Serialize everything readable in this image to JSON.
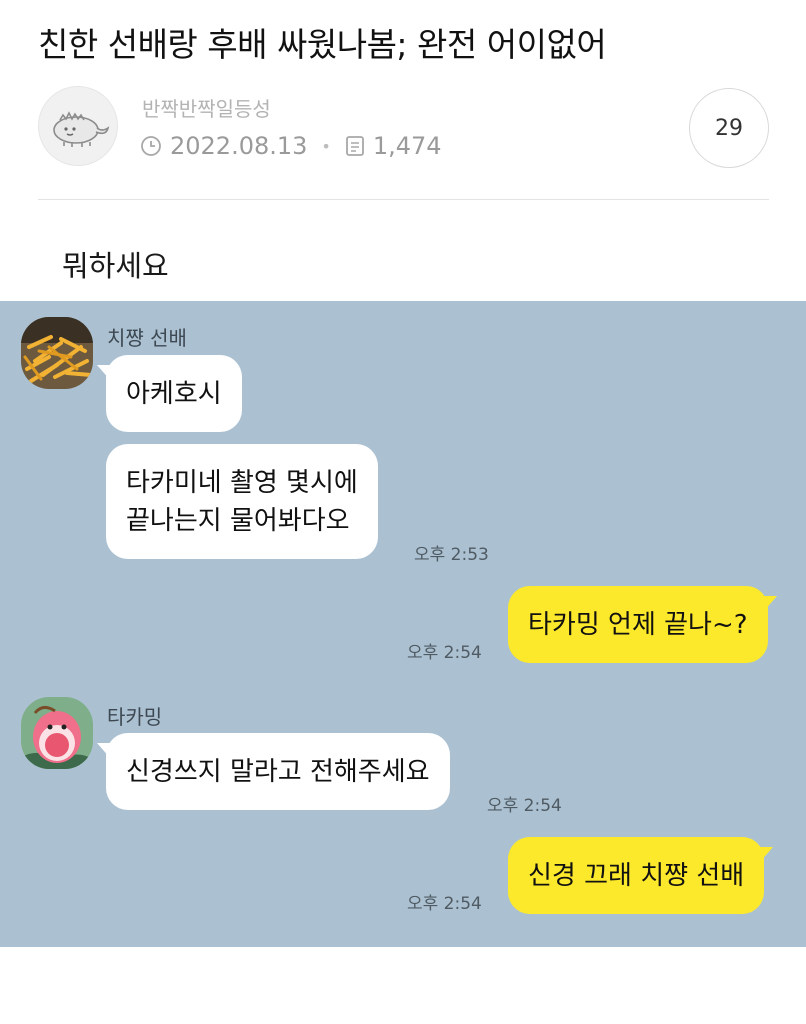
{
  "post": {
    "title": "친한 선배랑 후배 싸웠나봄; 완전 어이없어",
    "author": "반짝반짝일등성",
    "date": "2022.08.13",
    "views": "1,474",
    "comment_count": "29",
    "body_text": "뭐하세요"
  },
  "icons": {
    "clock": "clock-icon",
    "views": "document-icon"
  },
  "chat": {
    "sender1_name": "치쨩 선배",
    "msg1": "아케호시",
    "msg2_line1": "타카미네 촬영 몇시에",
    "msg2_line2": "끝나는지 물어봐다오",
    "time1": "오후 2:53",
    "out1": "타카밍 언제 끝나~?",
    "time2": "오후 2:54",
    "sender2_name": "타카밍",
    "msg3": "신경쓰지 말라고 전해주세요",
    "time3": "오후 2:54",
    "out2": "신경 끄래 치쨩 선배",
    "time4": "오후 2:54"
  },
  "colors": {
    "chat_background": "#abc1d1",
    "outgoing_bubble": "#fde92b",
    "incoming_bubble": "#ffffff"
  }
}
